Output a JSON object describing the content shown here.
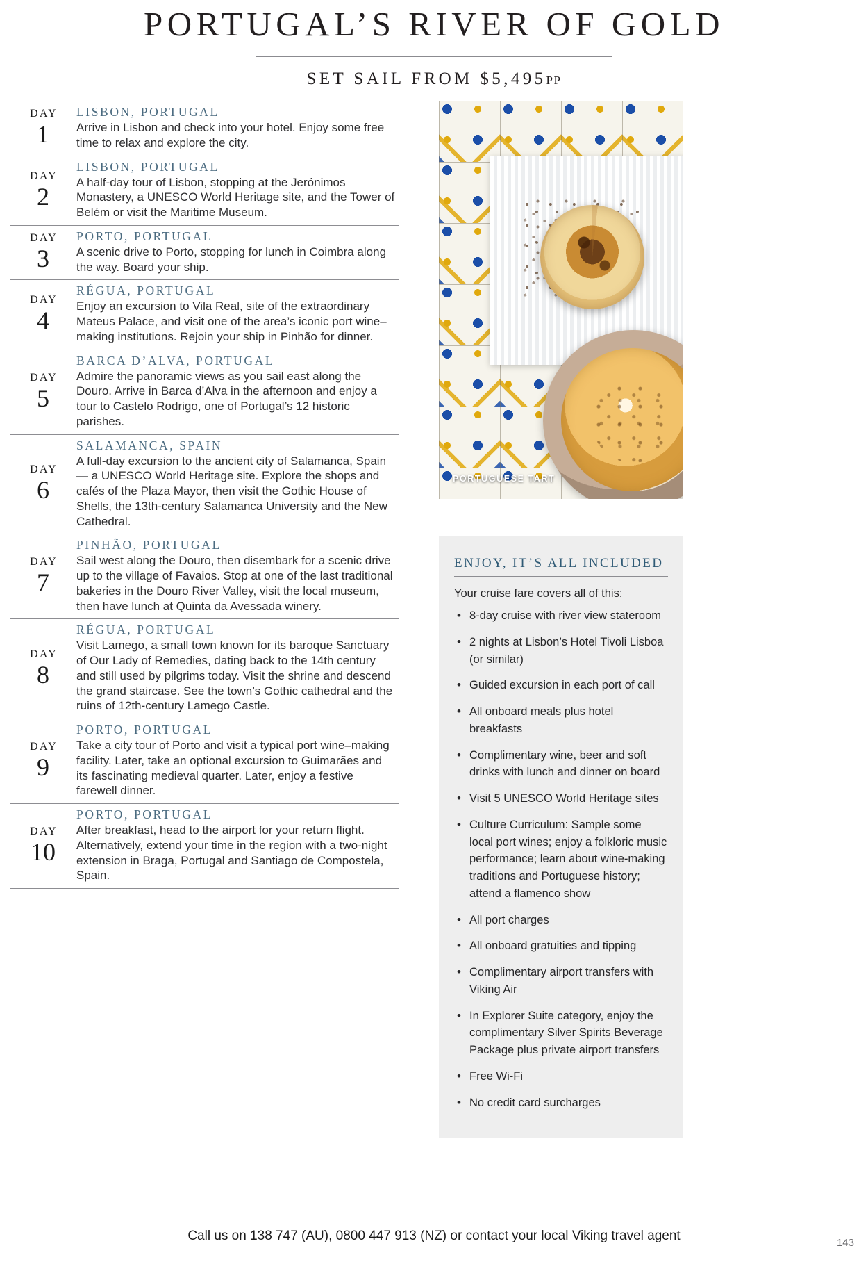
{
  "header": {
    "title": "PORTUGAL’S RIVER OF GOLD",
    "subtitle_main": "SET SAIL FROM $5,495",
    "subtitle_suffix": "PP"
  },
  "itinerary": [
    {
      "day_label": "DAY",
      "day_number": "1",
      "place": "LISBON, PORTUGAL",
      "description": "Arrive in Lisbon and check into your hotel. Enjoy some free time to relax and explore the city."
    },
    {
      "day_label": "DAY",
      "day_number": "2",
      "place": "LISBON, PORTUGAL",
      "description": "A half-day tour of Lisbon, stopping at the Jerónimos Monastery, a UNESCO World Heritage site, and the Tower of Belém or visit the Maritime Museum."
    },
    {
      "day_label": "DAY",
      "day_number": "3",
      "place": "PORTO, PORTUGAL",
      "description": "A scenic drive to Porto, stopping for lunch in Coimbra along the way. Board your ship."
    },
    {
      "day_label": "DAY",
      "day_number": "4",
      "place": "RÉGUA, PORTUGAL",
      "description": "Enjoy an excursion to Vila Real, site of the extraordinary Mateus Palace, and visit one of the area’s iconic port wine–making institutions. Rejoin your ship in Pinhão for dinner."
    },
    {
      "day_label": "DAY",
      "day_number": "5",
      "place": "BARCA D’ALVA, PORTUGAL",
      "description": "Admire the panoramic views as you sail east along the Douro. Arrive in Barca d’Alva in the afternoon and enjoy a tour to Castelo Rodrigo, one of Portugal’s 12 historic parishes."
    },
    {
      "day_label": "DAY",
      "day_number": "6",
      "place": "SALAMANCA, SPAIN",
      "description": "A full-day excursion to the ancient city of Salamanca, Spain — a UNESCO World Heritage site. Explore the shops and cafés of the Plaza Mayor, then visit the Gothic House of Shells, the 13th-century Salamanca University and the New Cathedral."
    },
    {
      "day_label": "DAY",
      "day_number": "7",
      "place": "PINHÃO, PORTUGAL",
      "description": "Sail west along the Douro, then disembark for a scenic drive up to the village of Favaios. Stop at one of the last traditional bakeries in the Douro River Valley, visit the local museum, then have lunch at Quinta da Avessada winery."
    },
    {
      "day_label": "DAY",
      "day_number": "8",
      "place": "RÉGUA, PORTUGAL",
      "description": "Visit Lamego, a small town known for its baroque Sanctuary of Our Lady of Remedies, dating back to the 14th century and still used by pilgrims today. Visit the shrine and descend the grand staircase. See the town’s Gothic cathedral and the ruins of 12th-century Lamego Castle."
    },
    {
      "day_label": "DAY",
      "day_number": "9",
      "place": "PORTO, PORTUGAL",
      "description": "Take a city tour of Porto and visit a typical port wine–making facility. Later, take an optional excursion to Guimarães and its fascinating medieval quarter. Later, enjoy a festive farewell dinner."
    },
    {
      "day_label": "DAY",
      "day_number": "10",
      "place": "PORTO, PORTUGAL",
      "description": "After breakfast, head to the airport for your return flight. Alternatively, extend your time in the region with a two-night extension in Braga, Portugal and Santiago de Compostela, Spain."
    }
  ],
  "photo": {
    "caption": "PORTUGUESE TART"
  },
  "included": {
    "title": "ENJOY, IT’S ALL INCLUDED",
    "intro": "Your cruise fare covers all of this:",
    "items": [
      "8-day cruise with river view stateroom",
      "2 nights at Lisbon’s Hotel Tivoli Lisboa (or similar)",
      "Guided excursion in each port of call",
      "All onboard meals plus hotel breakfasts",
      "Complimentary wine, beer and soft drinks with lunch and dinner on board",
      "Visit 5 UNESCO World Heritage sites",
      "Culture Curriculum: Sample some local port wines; enjoy a folkloric music performance; learn about wine-making traditions and Portuguese history; attend a flamenco show",
      "All port charges",
      "All onboard gratuities and tipping",
      "Complimentary airport transfers with Viking Air",
      "In Explorer Suite category, enjoy the complimentary Silver Spirits Beverage Package plus private airport transfers",
      "Free Wi-Fi",
      "No credit card surcharges"
    ]
  },
  "footer": {
    "call_text": "Call us on 138 747 (AU), 0800 447 913 (NZ) or contact your local Viking travel agent",
    "page_number": "143"
  },
  "colors": {
    "heading_blue": "#4b6b80",
    "included_title_blue": "#2f5a75",
    "rule_gray": "#8d8d92",
    "box_background": "#eeeeee"
  }
}
